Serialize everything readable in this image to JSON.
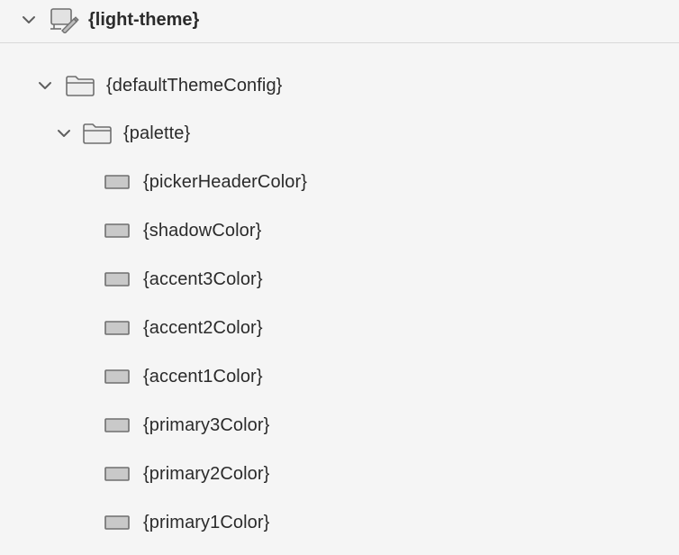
{
  "header": {
    "title": "{light-theme}",
    "expand_icon": "chevron-down-icon",
    "type_icon": "theme-icon"
  },
  "tree": {
    "root": {
      "label": "{defaultThemeConfig}",
      "icon": "folder-icon",
      "expanded": true
    },
    "group": {
      "label": "{palette}",
      "icon": "folder-icon",
      "expanded": true
    },
    "items": [
      {
        "label": "{pickerHeaderColor}",
        "icon": "color-swatch-icon"
      },
      {
        "label": "{shadowColor}",
        "icon": "color-swatch-icon"
      },
      {
        "label": "{accent3Color}",
        "icon": "color-swatch-icon"
      },
      {
        "label": "{accent2Color}",
        "icon": "color-swatch-icon"
      },
      {
        "label": "{accent1Color}",
        "icon": "color-swatch-icon"
      },
      {
        "label": "{primary3Color}",
        "icon": "color-swatch-icon"
      },
      {
        "label": "{primary2Color}",
        "icon": "color-swatch-icon"
      },
      {
        "label": "{primary1Color}",
        "icon": "color-swatch-icon"
      }
    ]
  },
  "colors": {
    "background": "#f5f5f5",
    "divider": "#d9d9d9",
    "text": "#2b2b2b",
    "icon_stroke": "#6f6f6f",
    "swatch_fill": "#c9c9c9"
  }
}
